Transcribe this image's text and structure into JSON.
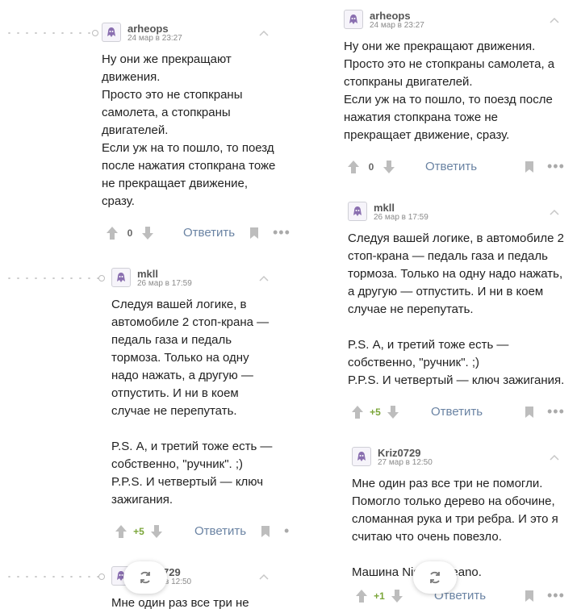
{
  "left": {
    "c1": {
      "author": "arheops",
      "date": "24 мар в 23:27",
      "lines": [
        "Ну они же прекращают",
        "движения.",
        "Просто это не стопкраны",
        "самолета, а стопкраны",
        "двигателей.",
        "Если уж на то пошло, то поезд",
        "после нажатия стопкрана тоже",
        "не прекращает движение,",
        "сразу."
      ],
      "score": "0",
      "reply": "Ответить"
    },
    "c2": {
      "author": "mkll",
      "date": "26 мар в 17:59",
      "lines": [
        "Следуя вашей логике, в",
        "автомобиле 2 стоп-крана —",
        "педаль газа и педаль",
        "тормоза. Только на одну",
        "надо нажать, а другую —",
        "отпустить. И ни в коем",
        "случае не перепутать.",
        "",
        "P.S. А, и третий тоже есть —",
        "собственно, \"ручник\". ;)",
        "P.P.S. И четвертый — ключ",
        "зажигания."
      ],
      "score": "+5",
      "reply": "Ответить"
    },
    "c3": {
      "author": "729",
      "date": "в 12:50",
      "lines": [
        "Мне один раз все три не"
      ]
    }
  },
  "right": {
    "c1": {
      "author": "arheops",
      "date": "24 мар в 23:27",
      "lines": [
        "Ну они же прекращают движения.",
        "Просто это не стопкраны самолета, а",
        "стопкраны двигателей.",
        "Если уж на то пошло, то поезд после",
        "нажатия стопкрана тоже не",
        "прекращает движение, сразу."
      ],
      "score": "0",
      "reply": "Ответить"
    },
    "c2": {
      "author": "mkll",
      "date": "26 мар в 17:59",
      "lines": [
        "Следуя вашей логике, в автомобиле 2",
        "стоп-крана — педаль газа и педаль",
        "тормоза. Только на одну надо нажать,",
        "а другую — отпустить. И ни в коем",
        "случае не перепутать.",
        "",
        "P.S. А, и третий тоже есть —",
        "собственно, \"ручник\". ;)",
        "P.P.S. И четвертый — ключ зажигания."
      ],
      "score": "+5",
      "reply": "Ответить"
    },
    "c3": {
      "author": "Kriz0729",
      "date": "27 мар в 12:50",
      "lines": [
        "Мне один раз все три не помогли.",
        "Помогло только дерево на обочине,",
        "сломанная рука и три ребра. И это я",
        "считаю что очень повезло.",
        "",
        "Машина Nis",
        "Teano."
      ],
      "score": "+1",
      "reply": "Ответить"
    }
  },
  "colors": {
    "reply": "#6a83a3",
    "positive": "#7ba63a",
    "avatar": "#8a6fb0"
  },
  "icons": [
    "avatar-icon",
    "collapse-chevron-icon",
    "upvote-icon",
    "downvote-icon",
    "bookmark-icon",
    "more-icon",
    "refresh-icon"
  ]
}
